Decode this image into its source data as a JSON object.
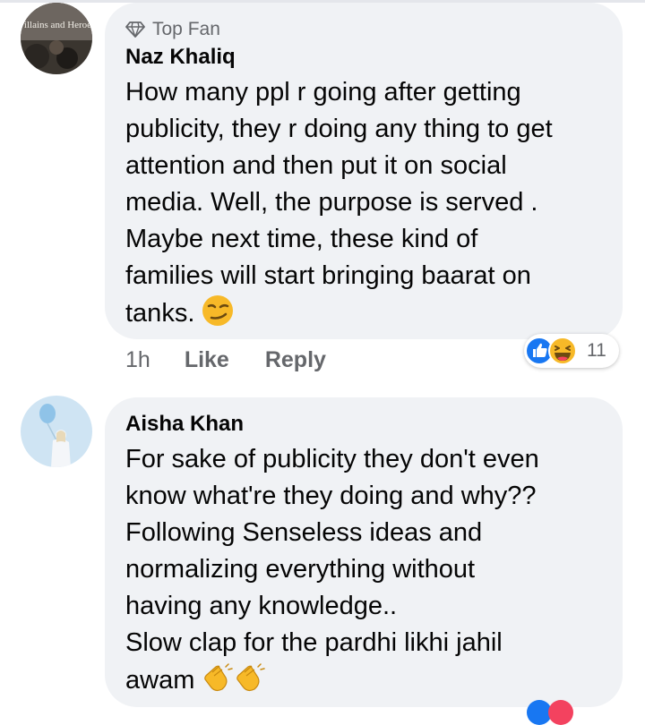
{
  "comments": [
    {
      "badge": "Top Fan",
      "author": "Naz Khaliq",
      "avatar_text": "Villains and Heroes",
      "lines": [
        "How many ppl r going after getting",
        "publicity, they r doing any thing to get",
        "attention and then put it on social",
        "media. Well, the purpose is served .",
        "Maybe next time, these kind of",
        "families will start bringing baarat on",
        "tanks. "
      ],
      "time": "1h",
      "like_label": "Like",
      "reply_label": "Reply",
      "reaction_count": "11",
      "reaction_icons": [
        "like-reaction-icon",
        "haha-reaction-icon"
      ]
    },
    {
      "author": "Aisha Khan",
      "lines": [
        "For sake of publicity they don't even",
        "know what're they doing and why??",
        "Following Senseless ideas and",
        "normalizing everything without",
        "having any knowledge..",
        "Slow clap for the pardhi likhi jahil",
        "awam "
      ]
    }
  ],
  "colors": {
    "bubble": "#f0f2f5",
    "text": "#050505",
    "secondary": "#65676b",
    "like_blue": "#1877f2",
    "haha_yellow": "#f7b928"
  }
}
